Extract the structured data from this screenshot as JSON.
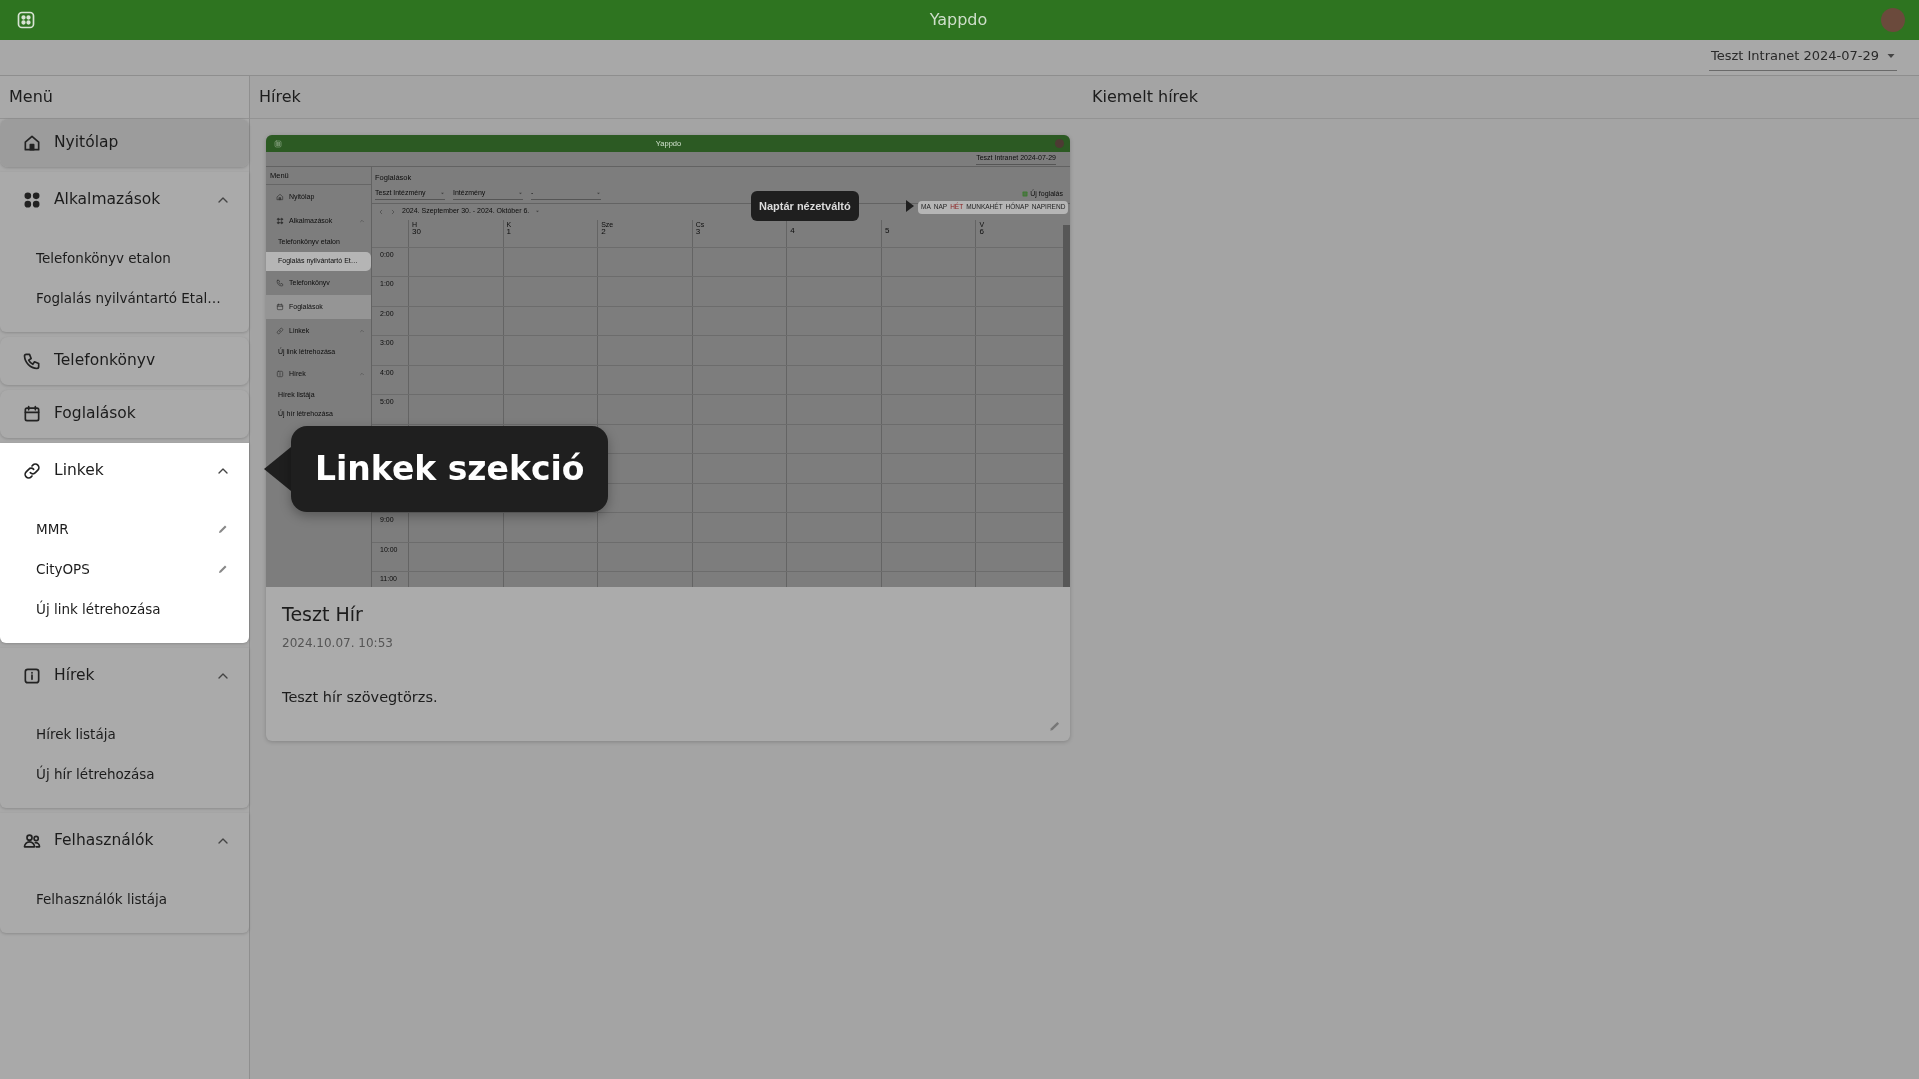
{
  "app_bar": {
    "title": "Yappdo"
  },
  "tenant_select": {
    "value": "Teszt Intranet 2024-07-29"
  },
  "sidebar": {
    "title": "Menü",
    "sections": [
      {
        "label": "Nyitólap",
        "kind": "link",
        "selected": true,
        "highlighted": false
      },
      {
        "label": "Alkalmazások",
        "kind": "group",
        "expanded": true,
        "highlighted": false,
        "children": [
          {
            "label": "Telefonkönyv etalon",
            "editable": false
          },
          {
            "label": "Foglalás nyilvántartó Etal…",
            "editable": false
          }
        ]
      },
      {
        "label": "Telefonkönyv",
        "kind": "link",
        "selected": false,
        "highlighted": false
      },
      {
        "label": "Foglalások",
        "kind": "link",
        "selected": false,
        "highlighted": false
      },
      {
        "label": "Linkek",
        "kind": "group",
        "expanded": true,
        "highlighted": true,
        "children": [
          {
            "label": "MMR",
            "editable": true
          },
          {
            "label": "CityOPS",
            "editable": true
          },
          {
            "label": "Új link létrehozása",
            "editable": false
          }
        ]
      },
      {
        "label": "Hírek",
        "kind": "group",
        "expanded": true,
        "highlighted": false,
        "children": [
          {
            "label": "Hírek listája",
            "editable": false
          },
          {
            "label": "Új hír létrehozása",
            "editable": false
          }
        ]
      },
      {
        "label": "Felhasználók",
        "kind": "group",
        "expanded": true,
        "highlighted": false,
        "children": [
          {
            "label": "Felhasználók listája",
            "editable": false
          }
        ]
      }
    ]
  },
  "news": {
    "title": "Hírek",
    "items": [
      {
        "title": "Teszt Hír",
        "date": "2024.10.07. 10:53",
        "body": "Teszt hír szövegtörzs.",
        "screenshot": {
          "app_title": "Yappdo",
          "tenant": "Teszt Intranet 2024-07-29",
          "menu_title": "Menü",
          "menu": [
            {
              "label": "Nyitólap",
              "kind": "item",
              "selected": false,
              "highlighted": false
            },
            {
              "label": "Alkalmazások",
              "kind": "group",
              "selected": false,
              "highlighted": false
            },
            {
              "label": "Telefonkönyv etalon",
              "kind": "sub",
              "selected": false,
              "highlighted": false
            },
            {
              "label": "Foglalás nyilvántartó Et…",
              "kind": "sub",
              "selected": false,
              "highlighted": true
            },
            {
              "label": "Telefonkönyv",
              "kind": "item",
              "selected": false,
              "highlighted": false
            },
            {
              "label": "Foglalások",
              "kind": "item",
              "selected": true,
              "highlighted": false
            },
            {
              "label": "Linkek",
              "kind": "group",
              "selected": false,
              "highlighted": false
            },
            {
              "label": "Új link létrehozása",
              "kind": "sub",
              "selected": false,
              "highlighted": false
            },
            {
              "label": "Hírek",
              "kind": "group",
              "selected": false,
              "highlighted": false
            },
            {
              "label": "Hírek listája",
              "kind": "sub",
              "selected": false,
              "highlighted": false
            },
            {
              "label": "Új hír létrehozása",
              "kind": "sub",
              "selected": false,
              "highlighted": false
            }
          ],
          "page_title": "Foglalások",
          "filters": [
            "Teszt Intézmény",
            "Intézmény",
            "-"
          ],
          "new_button": "Új foglalás",
          "date_range": "2024. Szeptember 30. - 2024. Október 6.",
          "view_switcher": [
            {
              "label": "MA",
              "selected": false
            },
            {
              "label": "NAP",
              "selected": false
            },
            {
              "label": "HÉT",
              "selected": true
            },
            {
              "label": "MUNKAHÉT",
              "selected": false
            },
            {
              "label": "HÓNAP",
              "selected": false
            },
            {
              "label": "NAPIREND",
              "selected": false
            }
          ],
          "tooltip": "Naptár nézetváltó",
          "days": [
            {
              "name": "H",
              "number": "30"
            },
            {
              "name": "K",
              "number": "1"
            },
            {
              "name": "Sze",
              "number": "2"
            },
            {
              "name": "Cs",
              "number": "3"
            },
            {
              "number": "4"
            },
            {
              "number": "5"
            },
            {
              "name": "V",
              "number": "6"
            }
          ],
          "hours": [
            "0:00",
            "1:00",
            "2:00",
            "3:00",
            "4:00",
            "5:00"
          ],
          "later_hours": [
            "9:00",
            "10:00",
            "11:00"
          ]
        }
      }
    ]
  },
  "featured": {
    "title": "Kiemelt hírek"
  },
  "tour_tooltip": {
    "text": "Linkek szekció"
  }
}
